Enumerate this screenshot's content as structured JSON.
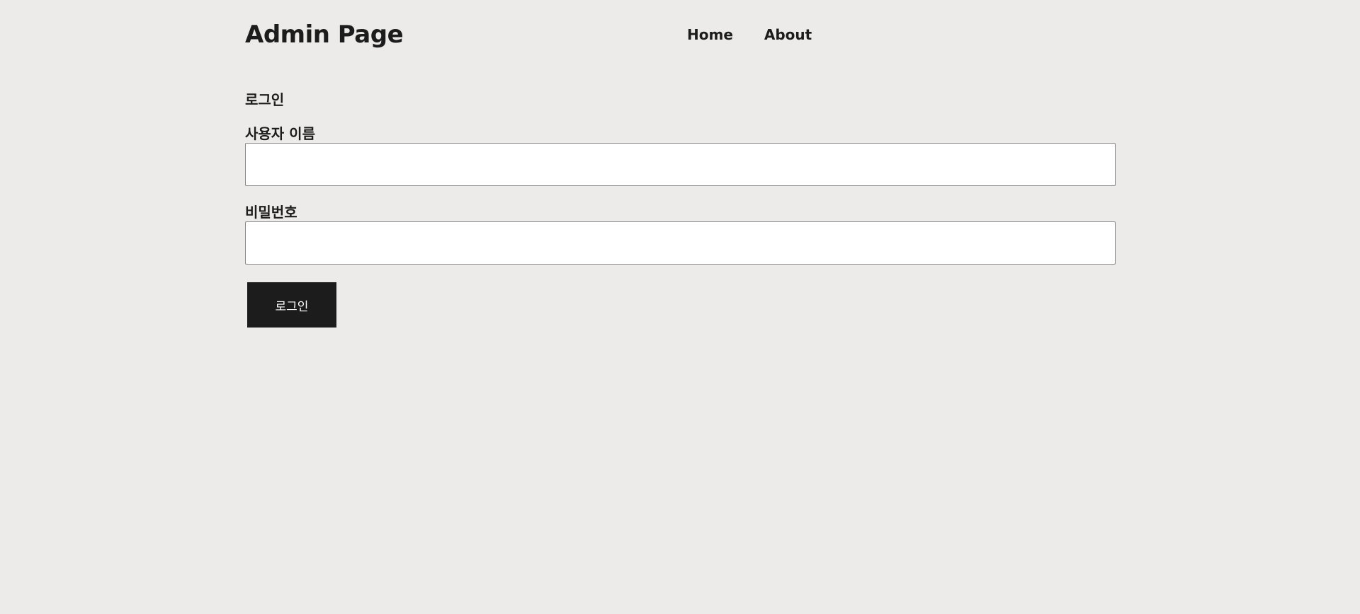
{
  "header": {
    "title": "Admin Page",
    "nav": [
      {
        "label": "Home"
      },
      {
        "label": "About"
      }
    ]
  },
  "login": {
    "heading": "로그인",
    "username": {
      "label": "사용자 이름",
      "value": "",
      "placeholder": ""
    },
    "password": {
      "label": "비밀번호",
      "value": "",
      "placeholder": ""
    },
    "submit_label": "로그인"
  },
  "colors": {
    "background": "#ecebe9",
    "text": "#1c1c1c",
    "button_background": "#1c1c1c",
    "button_text": "#ffffff",
    "input_background": "#ffffff",
    "input_border": "#8a8a8a"
  }
}
